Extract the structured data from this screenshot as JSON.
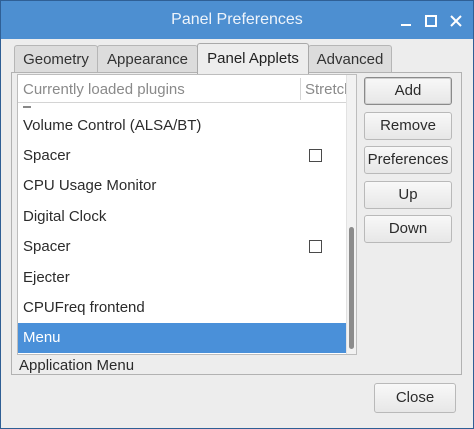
{
  "window": {
    "title": "Panel Preferences",
    "accent_color": "#4a90d9",
    "titlebar_color": "#4d8fd1",
    "controls": [
      "minimize-icon",
      "maximize-icon",
      "close-icon"
    ]
  },
  "tabs": [
    {
      "label": "Geometry",
      "active": false
    },
    {
      "label": "Appearance",
      "active": false
    },
    {
      "label": "Panel Applets",
      "active": true
    },
    {
      "label": "Advanced",
      "active": false
    }
  ],
  "plugin_list": {
    "columns": [
      "Currently loaded plugins",
      "Stretch"
    ],
    "rows": [
      {
        "label": "Volume Control (ALSA/BT)",
        "stretch": null,
        "selected": false
      },
      {
        "label": "Spacer",
        "stretch": false,
        "selected": false
      },
      {
        "label": "CPU Usage Monitor",
        "stretch": null,
        "selected": false
      },
      {
        "label": "Digital Clock",
        "stretch": null,
        "selected": false
      },
      {
        "label": "Spacer",
        "stretch": false,
        "selected": false
      },
      {
        "label": "Ejecter",
        "stretch": null,
        "selected": false
      },
      {
        "label": "CPUFreq frontend",
        "stretch": null,
        "selected": false
      },
      {
        "label": "Menu",
        "stretch": null,
        "selected": true
      }
    ]
  },
  "status": {
    "description": "Application Menu"
  },
  "buttons": {
    "add": "Add",
    "remove": "Remove",
    "preferences": "Preferences",
    "up": "Up",
    "down": "Down",
    "close": "Close"
  }
}
